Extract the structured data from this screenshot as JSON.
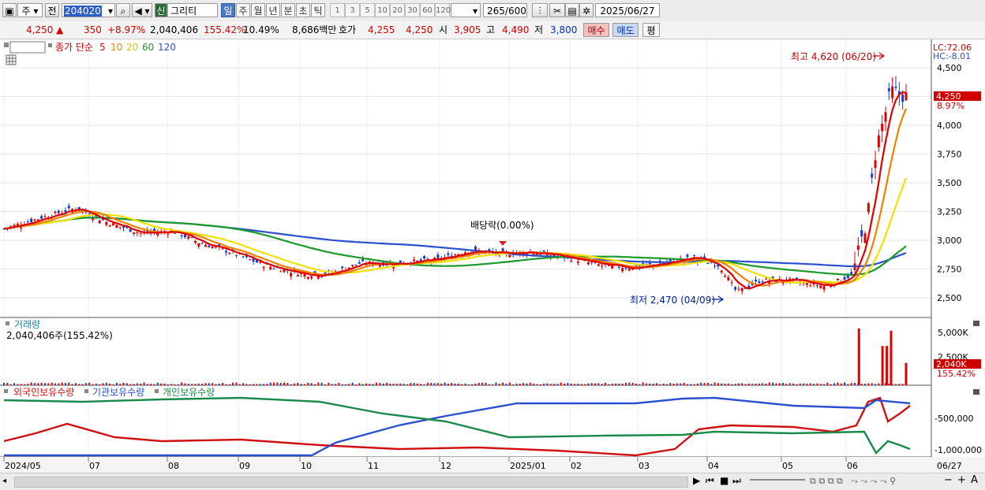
{
  "toolbar": {
    "market": "주",
    "prev_label": "전",
    "code": "204020",
    "name_prefix": "신",
    "name": "그리티",
    "periods": [
      "일",
      "주",
      "월",
      "년",
      "분",
      "초",
      "틱"
    ],
    "active_period": "일",
    "intervals": [
      "1",
      "3",
      "5",
      "10",
      "20",
      "30",
      "60",
      "120"
    ],
    "count": "265",
    "count_max": "/600",
    "date": "2025/06/27"
  },
  "quote": {
    "price": "4,250",
    "change": "350",
    "change_pct": "+8.97%",
    "volume": "2,040,406",
    "vol_ratio": "155.42%",
    "turnover": "10.49%",
    "amount": "8,686백만",
    "bidask_label": "호가",
    "ask": "4,255",
    "bid": "4,250",
    "open_label": "시",
    "open": "3,905",
    "high_label": "고",
    "high": "4,490",
    "low_label": "저",
    "low": "3,800",
    "buy_label": "매수",
    "sell_label": "매도",
    "eval_label": "평"
  },
  "chart_data": [
    {
      "type": "candlestick",
      "legend": {
        "name_tag": "그리티",
        "ma_title": "종가 단순",
        "ma_periods": [
          "5",
          "10",
          "20",
          "60",
          "120"
        ]
      },
      "series_colors": {
        "5": "#e00000",
        "10": "#f08000",
        "20": "#f2e000",
        "60": "#1a9a2a",
        "120": "#2a50d0"
      },
      "y_ticks": [
        "4,500",
        "4,250",
        "4,000",
        "3,750",
        "3,500",
        "3,250",
        "3,000",
        "2,750",
        "2,500"
      ],
      "ylim": [
        2400,
        4650
      ],
      "right_labels": {
        "lc": "LC:72.06",
        "hc": "HC:-8.01",
        "price": "4,250",
        "pct": "8.97%"
      },
      "annotations": {
        "high": "최고 4,620 (06/20)",
        "low": "최저 2,470 (04/09)",
        "dividend": "배당락(0.00%)"
      },
      "path_points": [
        [
          "2024-05-02",
          3100
        ],
        [
          "2024-05-20",
          3200
        ],
        [
          "2024-06-05",
          3280
        ],
        [
          "2024-06-20",
          3150
        ],
        [
          "2024-07-05",
          3060
        ],
        [
          "2024-07-20",
          3080
        ],
        [
          "2024-08-01",
          2980
        ],
        [
          "2024-08-15",
          2900
        ],
        [
          "2024-09-01",
          2780
        ],
        [
          "2024-09-20",
          2700
        ],
        [
          "2024-10-01",
          2710
        ],
        [
          "2024-10-15",
          2800
        ],
        [
          "2024-11-01",
          2800
        ],
        [
          "2024-11-20",
          2830
        ],
        [
          "2024-12-05",
          2910
        ],
        [
          "2024-12-20",
          2880
        ],
        [
          "2025-01-02",
          2900
        ],
        [
          "2025-01-20",
          2850
        ],
        [
          "2025-02-05",
          2780
        ],
        [
          "2025-02-20",
          2760
        ],
        [
          "2025-03-05",
          2800
        ],
        [
          "2025-03-20",
          2850
        ],
        [
          "2025-04-01",
          2780
        ],
        [
          "2025-04-09",
          2550
        ],
        [
          "2025-04-20",
          2650
        ],
        [
          "2025-05-05",
          2650
        ],
        [
          "2025-05-20",
          2600
        ],
        [
          "2025-06-02",
          2700
        ],
        [
          "2025-06-09",
          3200
        ],
        [
          "2025-06-13",
          3800
        ],
        [
          "2025-06-20",
          4300
        ],
        [
          "2025-06-27",
          4250
        ]
      ]
    },
    {
      "type": "bar",
      "title": "거래량",
      "summary": "2,040,406주(155.42%)",
      "y_ticks": [
        "5,000K",
        "2,500K"
      ],
      "right_labels": {
        "value": "2,040K",
        "pct": "155.42%"
      },
      "spikes": [
        [
          "2025-06-05",
          5200
        ],
        [
          "2025-06-16",
          3600
        ],
        [
          "2025-06-18",
          3600
        ],
        [
          "2025-06-20",
          5000
        ],
        [
          "2025-06-27",
          2040
        ]
      ]
    },
    {
      "type": "line",
      "legend": [
        "외국인보유수량",
        "기관보유수량",
        "개인보유수량"
      ],
      "series_colors": [
        "#d01010",
        "#2a50d0",
        "#1a8a4a"
      ],
      "y_ticks": [
        "-500,000",
        "-1,000,000"
      ],
      "x_ticks": [
        "2024/05",
        "07",
        "08",
        "09",
        "10",
        "11",
        "12",
        "2025/01",
        "02",
        "03",
        "04",
        "05",
        "06",
        "06/27"
      ]
    }
  ],
  "status": {
    "nav": [
      "▶",
      "⏮",
      "■",
      "⏭"
    ],
    "zoom": [
      "−",
      "+",
      "A"
    ]
  }
}
